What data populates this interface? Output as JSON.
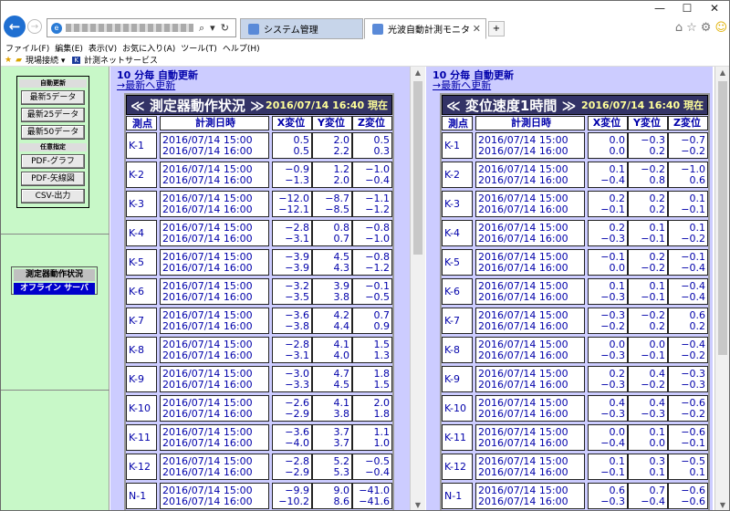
{
  "browser": {
    "tabs": [
      {
        "label": "システム管理",
        "active": false
      },
      {
        "label": "光波自動計測モニタ",
        "active": true
      }
    ],
    "menu": [
      "ファイル(F)",
      "編集(E)",
      "表示(V)",
      "お気に入り(A)",
      "ツール(T)",
      "ヘルプ(H)"
    ],
    "favorites": [
      "現場接続 ▾",
      "計測ネットサービス"
    ],
    "window_controls": [
      "—",
      "☐",
      "✕"
    ]
  },
  "sidebar": {
    "auto_update_header": "自動更新",
    "auto_buttons": [
      "最新5データ",
      "最新25データ",
      "最新50データ"
    ],
    "custom_header": "任意指定",
    "custom_buttons": [
      "PDF-グラフ",
      "PDF-矢線図",
      "CSV-出力"
    ],
    "status_title": "測定器動作状況",
    "status_value": "オフライン サーバ"
  },
  "left_table": {
    "refresh_text": "10 分毎 自動更新",
    "refresh_link": "→最新へ更新",
    "title": "≪ 測定器動作状況 ≫",
    "timestamp": "2016/07/14 16:40 現在",
    "headers": [
      "測点",
      "計測日時",
      "X変位",
      "Y変位",
      "Z変位"
    ],
    "rows": [
      {
        "pt": "K-1",
        "t1": "2016/07/14 15:00",
        "t2": "2016/07/14 16:00",
        "x1": "0.5",
        "x2": "0.5",
        "y1": "2.0",
        "y2": "2.2",
        "z1": "0.5",
        "z2": "0.3"
      },
      {
        "pt": "K-2",
        "t1": "2016/07/14 15:00",
        "t2": "2016/07/14 16:00",
        "x1": "−0.9",
        "x2": "−1.3",
        "y1": "1.2",
        "y2": "2.0",
        "z1": "−1.0",
        "z2": "−0.4"
      },
      {
        "pt": "K-3",
        "t1": "2016/07/14 15:00",
        "t2": "2016/07/14 16:00",
        "x1": "−12.0",
        "x2": "−12.1",
        "y1": "−8.7",
        "y2": "−8.5",
        "z1": "−1.1",
        "z2": "−1.2"
      },
      {
        "pt": "K-4",
        "t1": "2016/07/14 15:00",
        "t2": "2016/07/14 16:00",
        "x1": "−2.8",
        "x2": "−3.1",
        "y1": "0.8",
        "y2": "0.7",
        "z1": "−0.8",
        "z2": "−1.0"
      },
      {
        "pt": "K-5",
        "t1": "2016/07/14 15:00",
        "t2": "2016/07/14 16:00",
        "x1": "−3.9",
        "x2": "−3.9",
        "y1": "4.5",
        "y2": "4.3",
        "z1": "−0.8",
        "z2": "−1.2"
      },
      {
        "pt": "K-6",
        "t1": "2016/07/14 15:00",
        "t2": "2016/07/14 16:00",
        "x1": "−3.2",
        "x2": "−3.5",
        "y1": "3.9",
        "y2": "3.8",
        "z1": "−0.1",
        "z2": "−0.5"
      },
      {
        "pt": "K-7",
        "t1": "2016/07/14 15:00",
        "t2": "2016/07/14 16:00",
        "x1": "−3.6",
        "x2": "−3.8",
        "y1": "4.2",
        "y2": "4.4",
        "z1": "0.7",
        "z2": "0.9"
      },
      {
        "pt": "K-8",
        "t1": "2016/07/14 15:00",
        "t2": "2016/07/14 16:00",
        "x1": "−2.8",
        "x2": "−3.1",
        "y1": "4.1",
        "y2": "4.0",
        "z1": "1.5",
        "z2": "1.3"
      },
      {
        "pt": "K-9",
        "t1": "2016/07/14 15:00",
        "t2": "2016/07/14 16:00",
        "x1": "−3.0",
        "x2": "−3.3",
        "y1": "4.7",
        "y2": "4.5",
        "z1": "1.8",
        "z2": "1.5"
      },
      {
        "pt": "K-10",
        "t1": "2016/07/14 15:00",
        "t2": "2016/07/14 16:00",
        "x1": "−2.6",
        "x2": "−2.9",
        "y1": "4.1",
        "y2": "3.8",
        "z1": "2.0",
        "z2": "1.8"
      },
      {
        "pt": "K-11",
        "t1": "2016/07/14 15:00",
        "t2": "2016/07/14 16:00",
        "x1": "−3.6",
        "x2": "−4.0",
        "y1": "3.7",
        "y2": "3.7",
        "z1": "1.1",
        "z2": "1.0"
      },
      {
        "pt": "K-12",
        "t1": "2016/07/14 15:00",
        "t2": "2016/07/14 16:00",
        "x1": "−2.8",
        "x2": "−2.9",
        "y1": "5.2",
        "y2": "5.3",
        "z1": "−0.5",
        "z2": "−0.4"
      },
      {
        "pt": "N-1",
        "t1": "2016/07/14 15:00",
        "t2": "2016/07/14 16:00",
        "x1": "−9.9",
        "x2": "−10.2",
        "y1": "9.0",
        "y2": "8.6",
        "z1": "−41.0",
        "z2": "−41.6"
      }
    ]
  },
  "right_table": {
    "refresh_text": "10 分毎 自動更新",
    "refresh_link": "→最新へ更新",
    "title": "≪ 変位速度1時間 ≫",
    "timestamp": "2016/07/14 16:40 現在",
    "headers": [
      "測点",
      "計測日時",
      "X変位",
      "Y変位",
      "Z変位"
    ],
    "rows": [
      {
        "pt": "K-1",
        "t1": "2016/07/14 15:00",
        "t2": "2016/07/14 16:00",
        "x1": "0.0",
        "x2": "0.0",
        "y1": "−0.3",
        "y2": "0.2",
        "z1": "−0.7",
        "z2": "−0.2"
      },
      {
        "pt": "K-2",
        "t1": "2016/07/14 15:00",
        "t2": "2016/07/14 16:00",
        "x1": "0.1",
        "x2": "−0.4",
        "y1": "−0.2",
        "y2": "0.8",
        "z1": "−1.0",
        "z2": "0.6"
      },
      {
        "pt": "K-3",
        "t1": "2016/07/14 15:00",
        "t2": "2016/07/14 16:00",
        "x1": "0.2",
        "x2": "−0.1",
        "y1": "0.2",
        "y2": "0.2",
        "z1": "0.1",
        "z2": "−0.1"
      },
      {
        "pt": "K-4",
        "t1": "2016/07/14 15:00",
        "t2": "2016/07/14 16:00",
        "x1": "0.2",
        "x2": "−0.3",
        "y1": "0.1",
        "y2": "−0.1",
        "z1": "0.1",
        "z2": "−0.2"
      },
      {
        "pt": "K-5",
        "t1": "2016/07/14 15:00",
        "t2": "2016/07/14 16:00",
        "x1": "−0.1",
        "x2": "0.0",
        "y1": "0.2",
        "y2": "−0.2",
        "z1": "−0.1",
        "z2": "−0.4"
      },
      {
        "pt": "K-6",
        "t1": "2016/07/14 15:00",
        "t2": "2016/07/14 16:00",
        "x1": "0.1",
        "x2": "−0.3",
        "y1": "0.1",
        "y2": "−0.1",
        "z1": "−0.4",
        "z2": "−0.4"
      },
      {
        "pt": "K-7",
        "t1": "2016/07/14 15:00",
        "t2": "2016/07/14 16:00",
        "x1": "−0.3",
        "x2": "−0.2",
        "y1": "−0.2",
        "y2": "0.2",
        "z1": "0.6",
        "z2": "0.2"
      },
      {
        "pt": "K-8",
        "t1": "2016/07/14 15:00",
        "t2": "2016/07/14 16:00",
        "x1": "0.0",
        "x2": "−0.3",
        "y1": "0.0",
        "y2": "−0.1",
        "z1": "−0.4",
        "z2": "−0.2"
      },
      {
        "pt": "K-9",
        "t1": "2016/07/14 15:00",
        "t2": "2016/07/14 16:00",
        "x1": "0.2",
        "x2": "−0.3",
        "y1": "0.4",
        "y2": "−0.2",
        "z1": "−0.3",
        "z2": "−0.3"
      },
      {
        "pt": "K-10",
        "t1": "2016/07/14 15:00",
        "t2": "2016/07/14 16:00",
        "x1": "0.4",
        "x2": "−0.3",
        "y1": "0.4",
        "y2": "−0.3",
        "z1": "−0.6",
        "z2": "−0.2"
      },
      {
        "pt": "K-11",
        "t1": "2016/07/14 15:00",
        "t2": "2016/07/14 16:00",
        "x1": "0.0",
        "x2": "−0.4",
        "y1": "0.1",
        "y2": "0.0",
        "z1": "−0.6",
        "z2": "−0.1"
      },
      {
        "pt": "K-12",
        "t1": "2016/07/14 15:00",
        "t2": "2016/07/14 16:00",
        "x1": "0.1",
        "x2": "−0.1",
        "y1": "0.3",
        "y2": "0.1",
        "z1": "−0.5",
        "z2": "0.1"
      },
      {
        "pt": "N-1",
        "t1": "2016/07/14 15:00",
        "t2": "2016/07/14 16:00",
        "x1": "0.6",
        "x2": "−0.3",
        "y1": "0.7",
        "y2": "−0.4",
        "z1": "−0.6",
        "z2": "−0.6"
      }
    ]
  },
  "colors": {
    "pane_bg": "#ccccff",
    "sidebar_bg": "#c8f8c8",
    "header_bg": "#333366",
    "value_text": "#0000aa"
  }
}
